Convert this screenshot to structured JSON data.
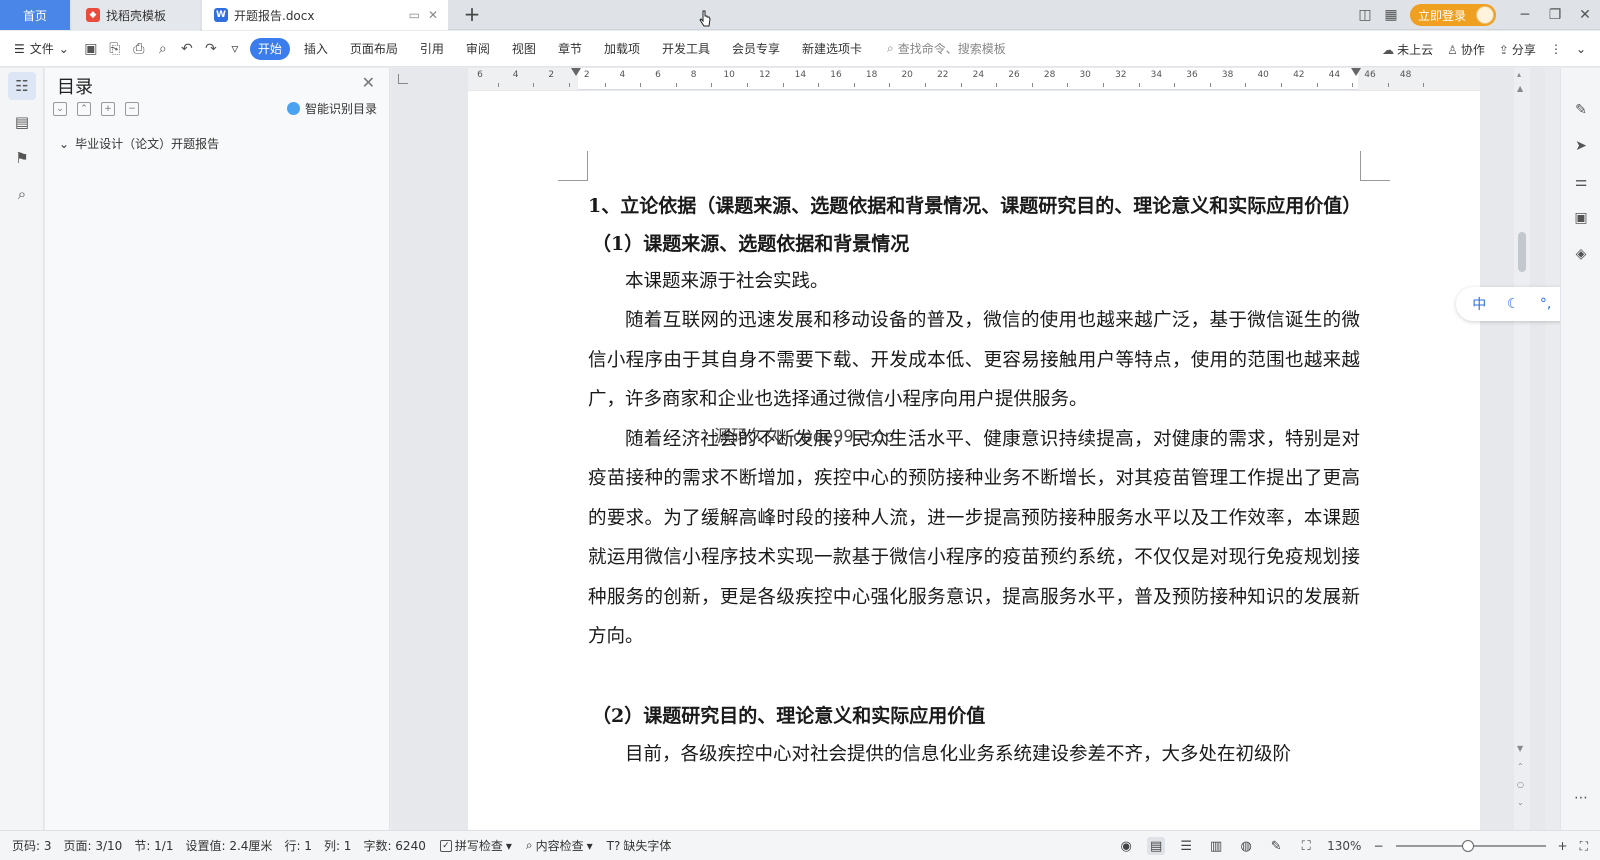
{
  "tabs": {
    "home": "首页",
    "templates": "找稻壳模板",
    "document": "开题报告.docx"
  },
  "top_right": {
    "login": "立即登录"
  },
  "ribbon": {
    "file": "文件",
    "tabs": [
      "开始",
      "插入",
      "页面布局",
      "引用",
      "审阅",
      "视图",
      "章节",
      "加载项",
      "开发工具",
      "会员专享",
      "新建选项卡"
    ],
    "active_tab": "开始",
    "search_placeholder": "查找命令、搜索模板",
    "cloud": "未上云",
    "collab": "协作",
    "share": "分享"
  },
  "toc": {
    "title": "目录",
    "smart": "智能识别目录",
    "items": [
      "毕业设计（论文）开题报告"
    ]
  },
  "ruler": {
    "labels": [
      "6",
      "4",
      "2",
      "2",
      "4",
      "6",
      "8",
      "10",
      "12",
      "14",
      "16",
      "18",
      "20",
      "22",
      "24",
      "26",
      "28",
      "30",
      "32",
      "34",
      "36",
      "38",
      "40",
      "42",
      "44",
      "46",
      "48"
    ]
  },
  "document": {
    "heading1": "1、立论依据（课题来源、选题依据和背景情况、课题研究目的、理论意义和实际应用价值）",
    "heading2a": "（1）课题来源、选题依据和背景情况",
    "p1": "本课题来源于社会实践。",
    "p2": "随着互联网的迅速发展和移动设备的普及，微信的使用也越来越广泛，基于微信诞生的微信小程序由于其自身不需要下载、开发成本低、更容易接触用户等特点，使用的范围也越来越广，许多商家和企业也选择通过微信小程序向用户提供服务。",
    "p3": "随着经济社会的不断发展，民众生活水平、健康意识持续提高，对健康的需求，特别是对疫苗接种的需求不断增加，疾控中心的预防接种业务不断增长，对其疫苗管理工作提出了更高的要求。为了缓解高峰时段的接种人流，进一步提高预防接种服务水平以及工作效率，本课题就运用微信小程序技术实现一款基于微信小程序的疫苗预约系统，不仅仅是对现行免疫规划接种服务的创新，更是各级疾控中心强化服务意识，提高服务水平，普及预防接种知识的发展新方向。",
    "heading2b": "（2）课题研究目的、理论意义和实际应用价值",
    "p4": "目前，各级疾控中心对社会提供的信息化业务系统建设参差不齐，大多处在初级阶",
    "watermark": "源码久久 code99.top"
  },
  "ime": {
    "lang": "中"
  },
  "status": {
    "page_code": "页码: 3",
    "page": "页面: 3/10",
    "section": "节: 1/1",
    "setting": "设置值: 2.4厘米",
    "row": "行: 1",
    "col": "列: 1",
    "words": "字数: 6240",
    "spell": "拼写检查",
    "content_check": "内容检查",
    "missing_font": "缺失字体",
    "zoom": "130%"
  }
}
